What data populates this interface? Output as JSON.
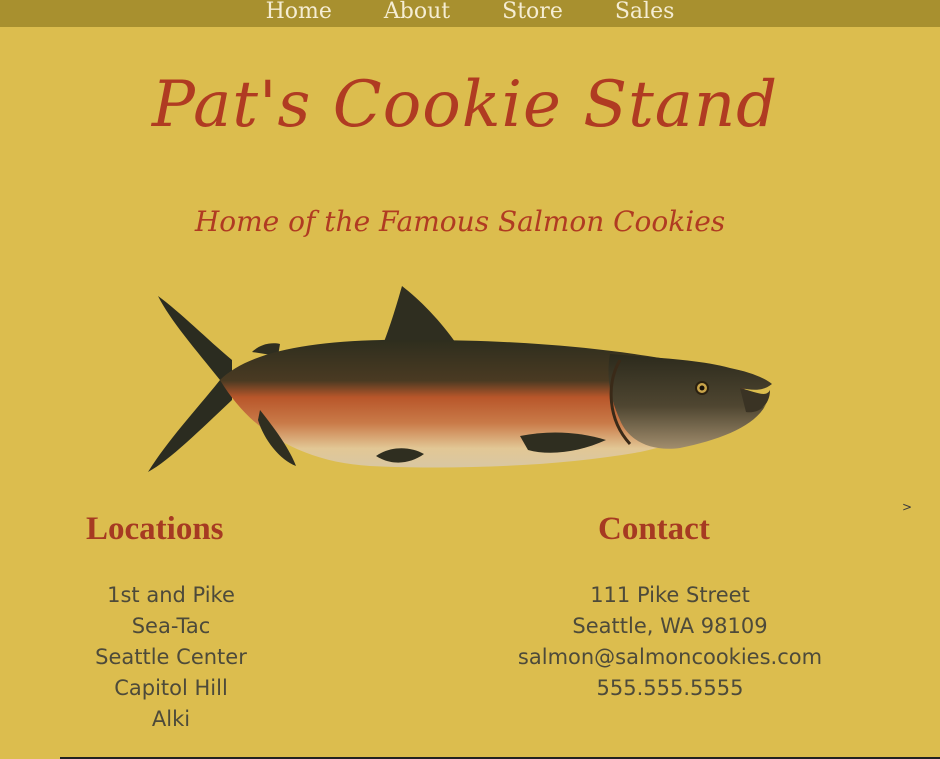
{
  "nav": {
    "items": [
      {
        "label": "Home"
      },
      {
        "label": "About"
      },
      {
        "label": "Store"
      },
      {
        "label": "Sales"
      }
    ]
  },
  "header": {
    "title": "Pat's Cookie Stand",
    "subtitle": "Home of the Famous Salmon Cookies"
  },
  "locations": {
    "heading": "Locations",
    "items": [
      "1st and Pike",
      "Sea-Tac",
      "Seattle Center",
      "Capitol Hill",
      "Alki"
    ]
  },
  "contact": {
    "heading": "Contact",
    "address_line1": "111 Pike Street",
    "address_line2": "Seattle, WA 98109",
    "email": "salmon@salmoncookies.com",
    "phone": "555.555.5555"
  },
  "misc": {
    "arrow": ">"
  },
  "colors": {
    "background": "#dcbd4e",
    "nav_bar": "#a8902f",
    "heading_red": "#b03b22",
    "body_text": "#4d4a3a"
  }
}
